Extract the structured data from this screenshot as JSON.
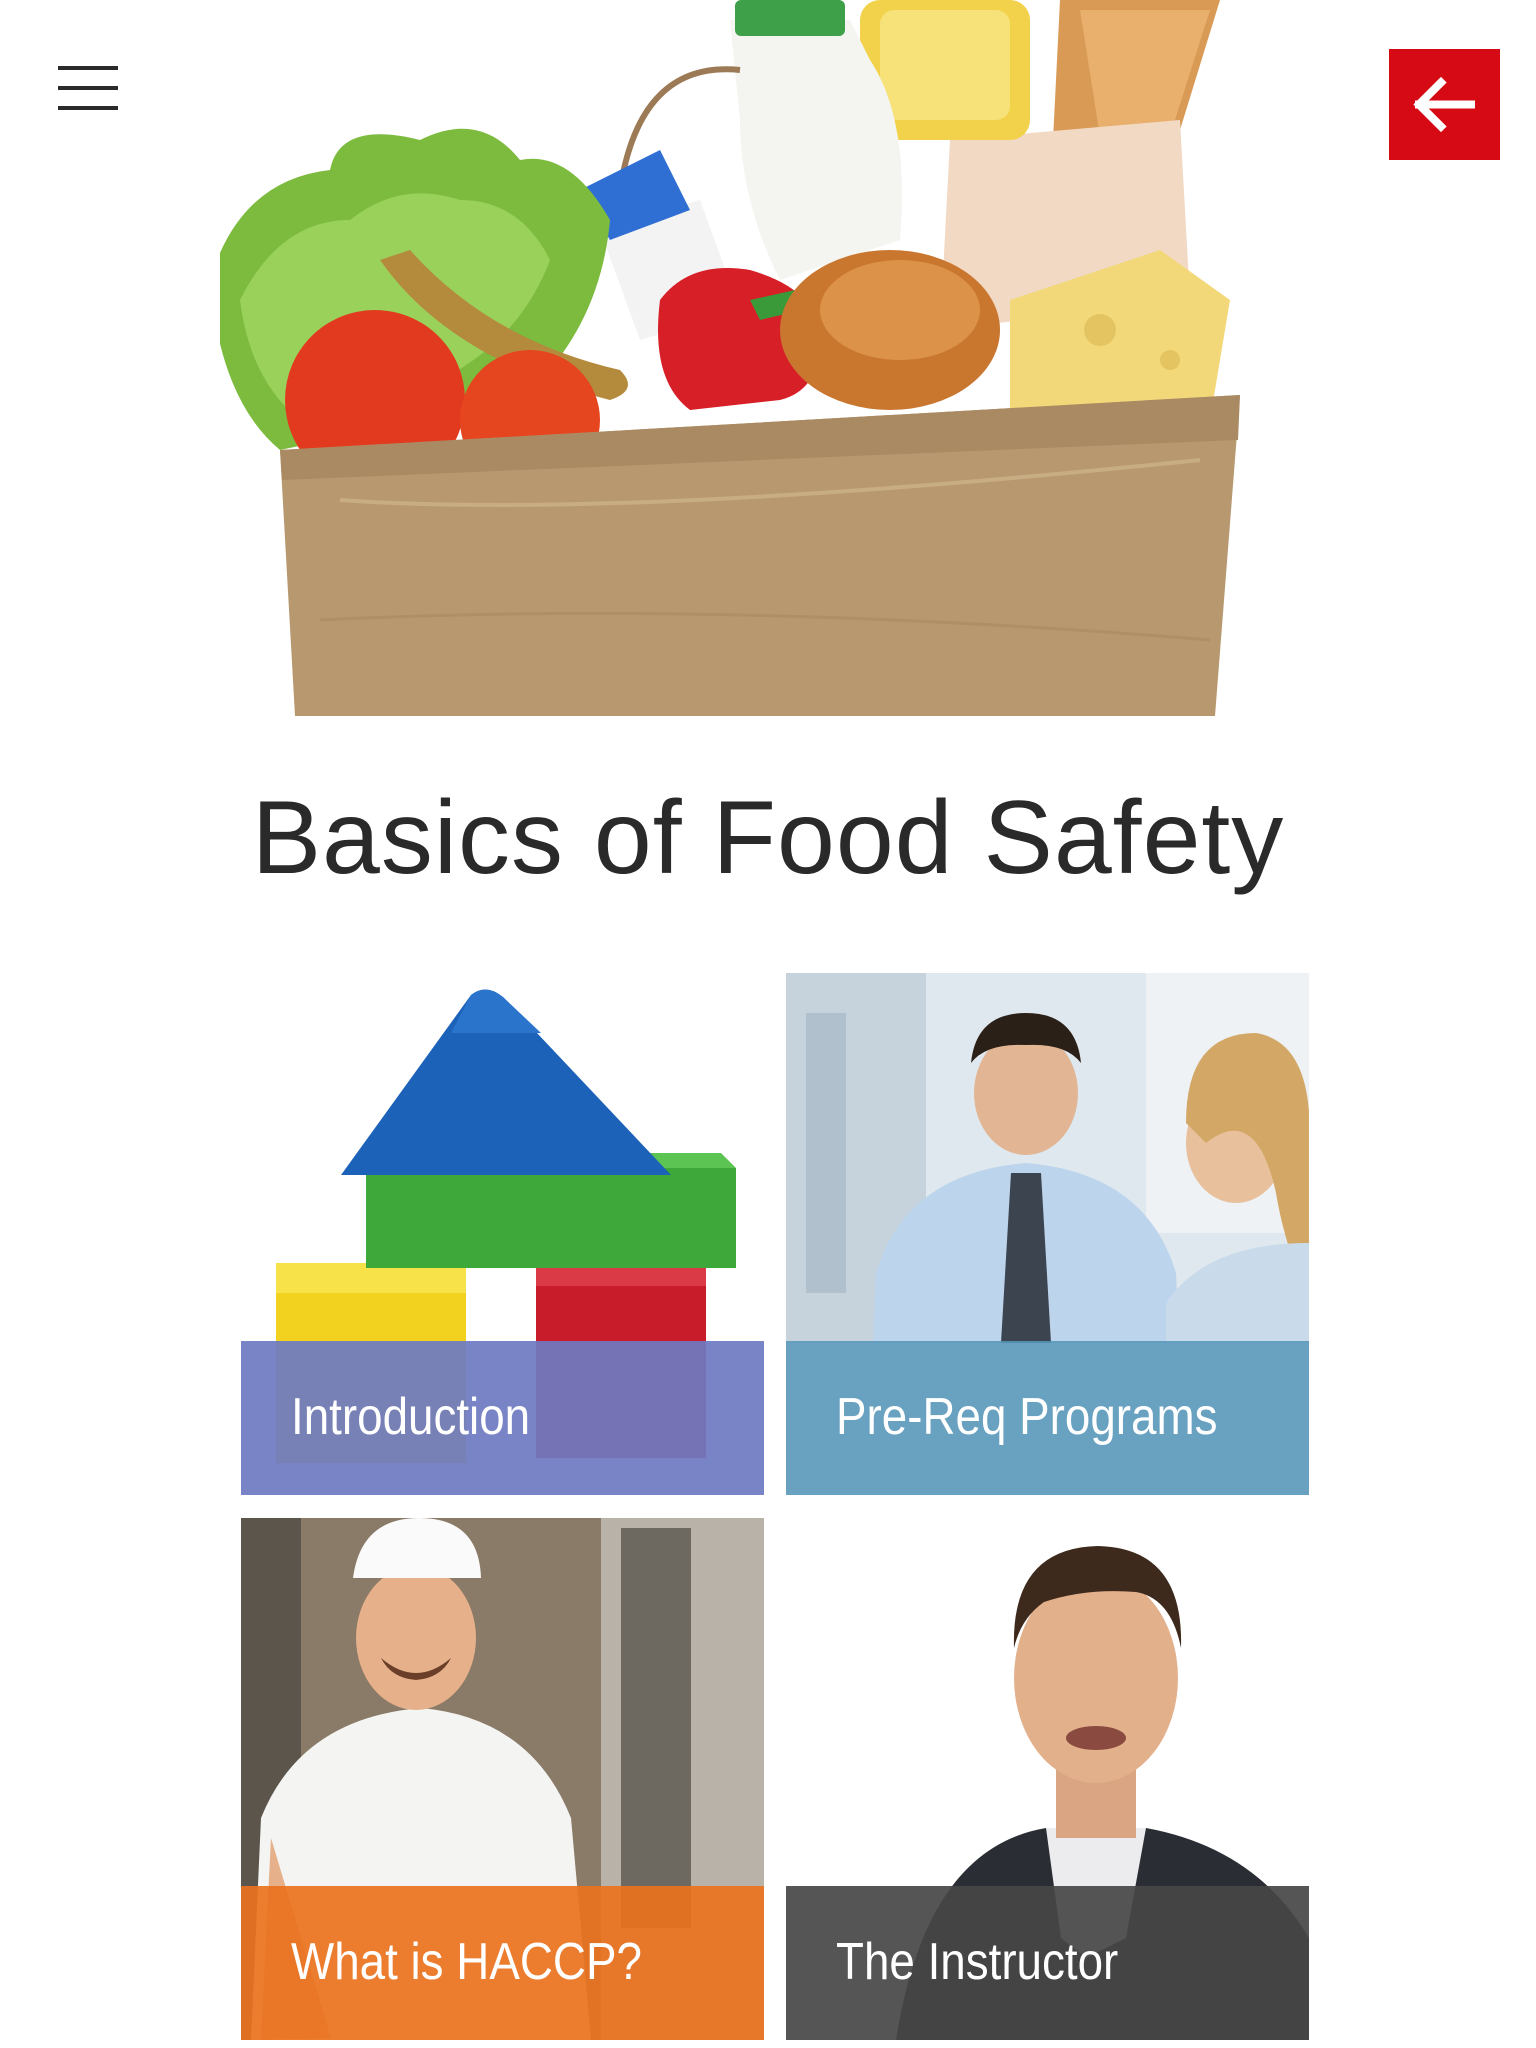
{
  "header": {
    "menu_icon": "hamburger-menu-icon",
    "back_icon": "arrow-left-icon",
    "back_color": "#d50a14"
  },
  "hero": {
    "image": "grocery-bag-illustration"
  },
  "page": {
    "title": "Basics of Food Safety"
  },
  "tiles": [
    {
      "label": "Introduction",
      "image": "toy-blocks-house",
      "overlay_color": "#7a86c8"
    },
    {
      "label": "Pre-Req Programs",
      "image": "business-people-meeting",
      "overlay_color": "#5a9bbd"
    },
    {
      "label": "What is HACCP?",
      "image": "baker-in-kitchen",
      "overlay_color": "#e8741e"
    },
    {
      "label": "The Instructor",
      "image": "instructor-portrait",
      "overlay_color": "#4a4a4a"
    }
  ]
}
